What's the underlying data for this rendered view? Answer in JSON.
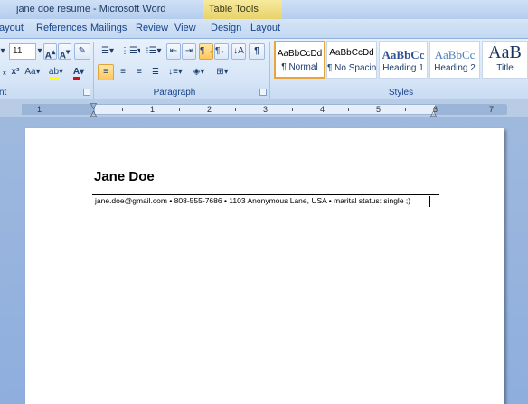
{
  "window": {
    "title": "jane doe resume - Microsoft Word",
    "context_tab": "Table Tools"
  },
  "ribbon_tabs": [
    "ayout",
    "References",
    "Mailings",
    "Review",
    "View",
    "Design",
    "Layout"
  ],
  "font_group": {
    "font_size": "11",
    "label": "nt"
  },
  "paragraph_group": {
    "label": "Paragraph"
  },
  "styles_group": {
    "label": "Styles",
    "items": [
      {
        "preview": "AaBbCcDd",
        "name": "¶ Normal"
      },
      {
        "preview": "AaBbCcDd",
        "name": "¶ No Spacing"
      },
      {
        "preview": "AaBbCc",
        "name": "Heading 1"
      },
      {
        "preview": "AaBbCc",
        "name": "Heading 2"
      },
      {
        "preview": "AaB",
        "name": "Title"
      }
    ]
  },
  "ruler": {
    "numbers": [
      "1",
      "1",
      "2",
      "3",
      "4",
      "5",
      "6",
      "7"
    ]
  },
  "document": {
    "name": "Jane Doe",
    "contact_line": "jane.doe@gmail.com • 808-555-7686 •  1103 Anonymous Lane, USA  • marital status: single ;)"
  },
  "colors": {
    "highlight": "#ffff00",
    "font_color": "#d01010",
    "selected_style_border": "#e8a53b"
  }
}
